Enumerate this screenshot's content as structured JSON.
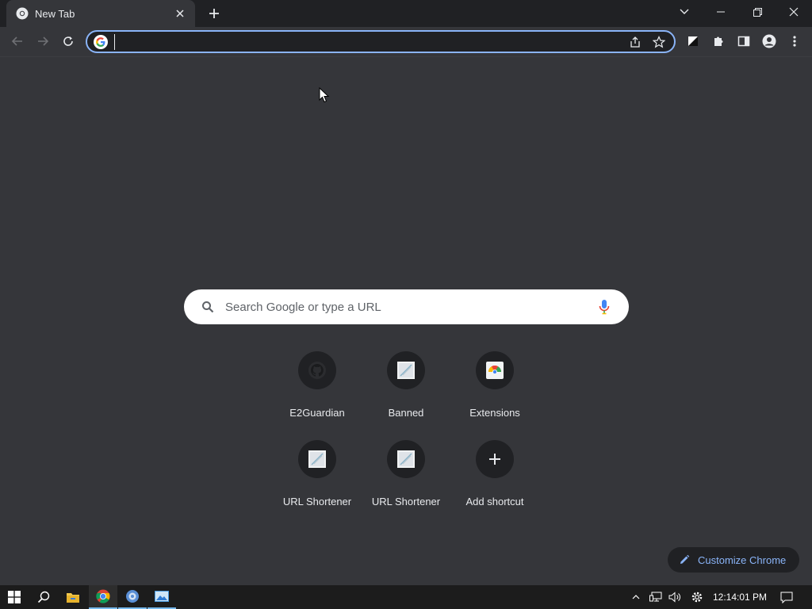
{
  "window": {
    "tab_title": "New Tab",
    "new_tab_tooltip": "New tab"
  },
  "omnibox": {
    "value": "",
    "placeholder": ""
  },
  "ntp": {
    "search_placeholder": "Search Google or type a URL",
    "shortcuts": [
      {
        "label": "E2Guardian",
        "icon": "github-icon"
      },
      {
        "label": "Banned",
        "icon": "broken-image-icon"
      },
      {
        "label": "Extensions",
        "icon": "chrome-extensions-icon"
      },
      {
        "label": "URL Shortener",
        "icon": "broken-image-icon"
      },
      {
        "label": "URL Shortener",
        "icon": "broken-image-icon"
      },
      {
        "label": "Add shortcut",
        "icon": "plus-icon"
      }
    ],
    "customize_label": "Customize Chrome"
  },
  "taskbar": {
    "clock": "12:14:01 PM"
  },
  "colors": {
    "accent": "#8ab4f8",
    "background": "#35363a",
    "tabstrip": "#202124"
  }
}
